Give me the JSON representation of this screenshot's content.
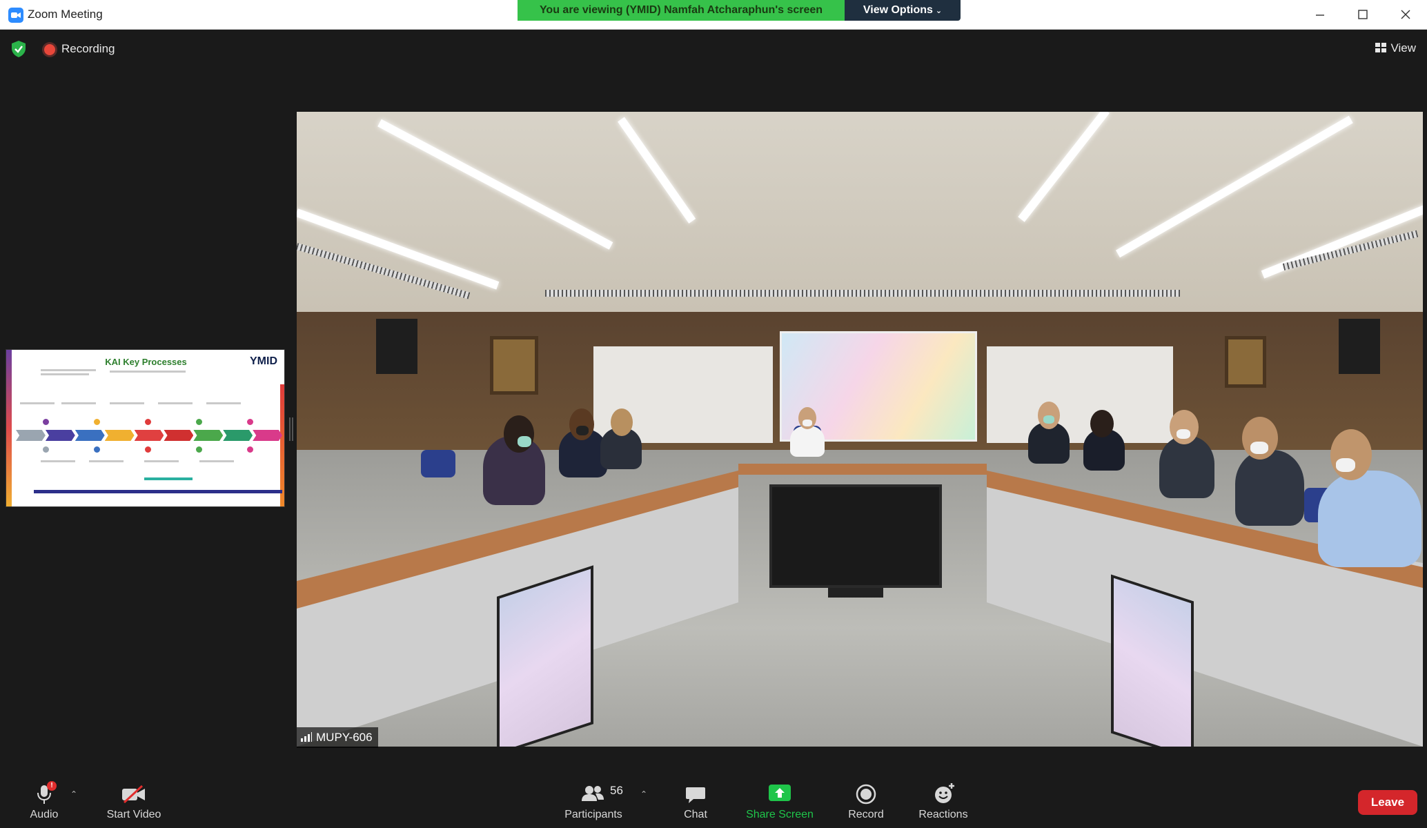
{
  "window": {
    "title": "Zoom Meeting",
    "viewing_banner": "You are viewing (YMID) Namfah Atcharaphun's screen",
    "view_options_label": "View Options"
  },
  "top_bar": {
    "recording_label": "Recording",
    "view_label": "View"
  },
  "shared_screen": {
    "slide_title": "KAI Key Processes",
    "slide_logo": "YMID"
  },
  "main_video": {
    "participant_name": "MUPY-606"
  },
  "toolbar": {
    "audio_label": "Audio",
    "start_video_label": "Start Video",
    "participants_label": "Participants",
    "participants_count": "56",
    "chat_label": "Chat",
    "share_screen_label": "Share Screen",
    "record_label": "Record",
    "reactions_label": "Reactions",
    "leave_label": "Leave",
    "audio_alert": "!"
  },
  "colors": {
    "banner_green": "#36c24a",
    "share_green": "#1fc54a",
    "leave_red": "#d4262b",
    "recording_red": "#e8473a",
    "zoom_blue": "#2d8cff"
  },
  "icons": [
    "zoom-app-icon",
    "minimize-icon",
    "maximize-icon",
    "close-icon",
    "security-shield-icon",
    "recording-dot-icon",
    "view-grid-icon",
    "signal-bars-icon",
    "microphone-icon",
    "video-off-icon",
    "participants-icon",
    "chat-icon",
    "share-screen-icon",
    "record-icon",
    "reactions-icon",
    "chevron-up-icon",
    "chevron-down-icon"
  ]
}
